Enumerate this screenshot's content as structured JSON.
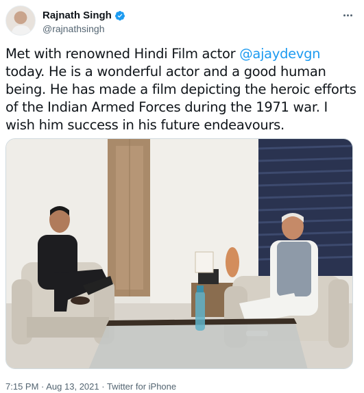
{
  "author": {
    "display_name": "Rajnath Singh",
    "handle": "@rajnathsingh",
    "avatar_icon": "profile-avatar",
    "verified_icon": "verified-badge-icon",
    "verified_color": "#1d9bf0"
  },
  "tweet": {
    "text_before": "Met with renowned Hindi Film actor ",
    "mention": "@ajaydevgn",
    "text_after": " today. He is a wonderful actor and a good human being. He has made a film depicting the heroic efforts of the Indian Armed Forces during the 1971 war. I wish him success in his future endeavours.",
    "mention_color": "#1d9bf0"
  },
  "footer": {
    "time": "7:15 PM",
    "separator": " · ",
    "date": "Aug 13, 2021",
    "source": "Twitter for iPhone"
  },
  "menu": {
    "icon": "more-options-icon"
  }
}
